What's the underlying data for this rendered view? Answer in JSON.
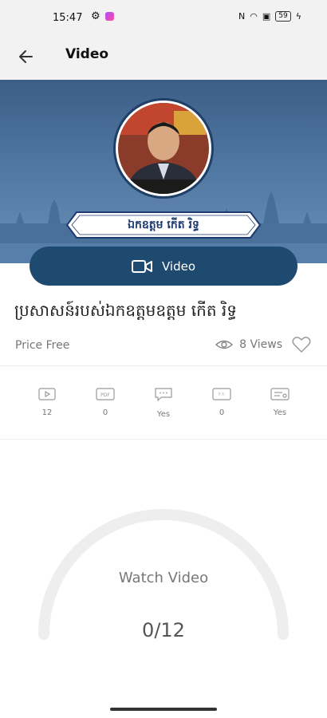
{
  "status_bar": {
    "time": "15:47",
    "battery": "59"
  },
  "app_bar": {
    "title": "Video"
  },
  "hero": {
    "name_plate": "ឯកឧត្តម កើត រិទ្ធ"
  },
  "video_button": {
    "label": "Video"
  },
  "course": {
    "title": "ប្រសាសន៍របស់ឯកឧត្តមឧត្តម កើត រិទ្ធ",
    "price": "Price Free",
    "views": "8 Views"
  },
  "stats": [
    {
      "icon": "video-icon",
      "value": "12"
    },
    {
      "icon": "pdf-icon",
      "value": "0"
    },
    {
      "icon": "chat-icon",
      "value": "Yes"
    },
    {
      "icon": "quiz-icon",
      "value": "0"
    },
    {
      "icon": "certificate-icon",
      "value": "Yes"
    }
  ],
  "progress": {
    "label": "Watch Video",
    "count": "0/12",
    "fraction": 0
  },
  "colors": {
    "primary": "#1d4a6e",
    "hero": "#4f76a0"
  }
}
